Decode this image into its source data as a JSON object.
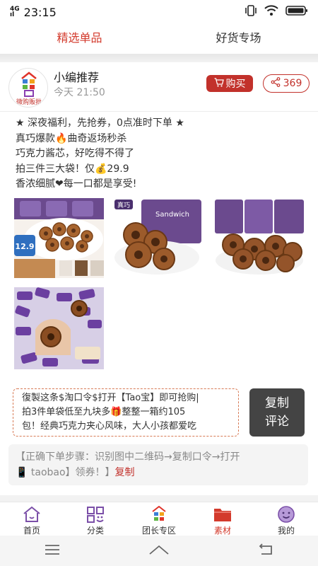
{
  "status_bar": {
    "network": "4G",
    "network_sub": "ıl",
    "time": "23:15"
  },
  "top_tabs": [
    {
      "label": "精选单品",
      "active": true
    },
    {
      "label": "好货专场",
      "active": false
    }
  ],
  "post": {
    "avatar_logo_text": "微购贩批",
    "author": "小编推荐",
    "time": "今天 21:50",
    "buy_label": "购买",
    "share_count": "369",
    "description_lines": [
      "★ 深夜福利，先抢券，0点准时下单 ★",
      "真巧爆款🔥曲奇返场秒杀",
      "巧克力酱芯，好吃得不得了",
      "拍三件三大袋！仅💰29.9",
      "香浓细腻❤每一口都是享受!"
    ],
    "image_price_tag": "12.9",
    "image_brand_text": "真巧",
    "copy_text_lines": [
      "復製这条$淘口令$打开【Tao宝】即可抢购|",
      "拍3件单袋低至九块多🎁整整一箱约105",
      "包！经典巧克力夹心风味，大人小孩都爱吃"
    ],
    "copy_button_line1": "复制",
    "copy_button_line2": "评论",
    "steps_line1": "【正确下单步骤：识别图中二维码→复制口令→打开",
    "steps_line2_prefix": "📱 taobao】领券！】",
    "steps_link": "复制"
  },
  "bottom_nav": [
    {
      "label": "首页",
      "icon": "home-icon",
      "active": false
    },
    {
      "label": "分类",
      "icon": "category-icon",
      "active": false
    },
    {
      "label": "团长专区",
      "icon": "leader-zone-icon",
      "active": false
    },
    {
      "label": "素材",
      "icon": "folder-icon",
      "active": true
    },
    {
      "label": "我的",
      "icon": "profile-icon",
      "active": false
    }
  ],
  "colors": {
    "accent": "#c2312b",
    "active_tab": "#d33a2c"
  }
}
